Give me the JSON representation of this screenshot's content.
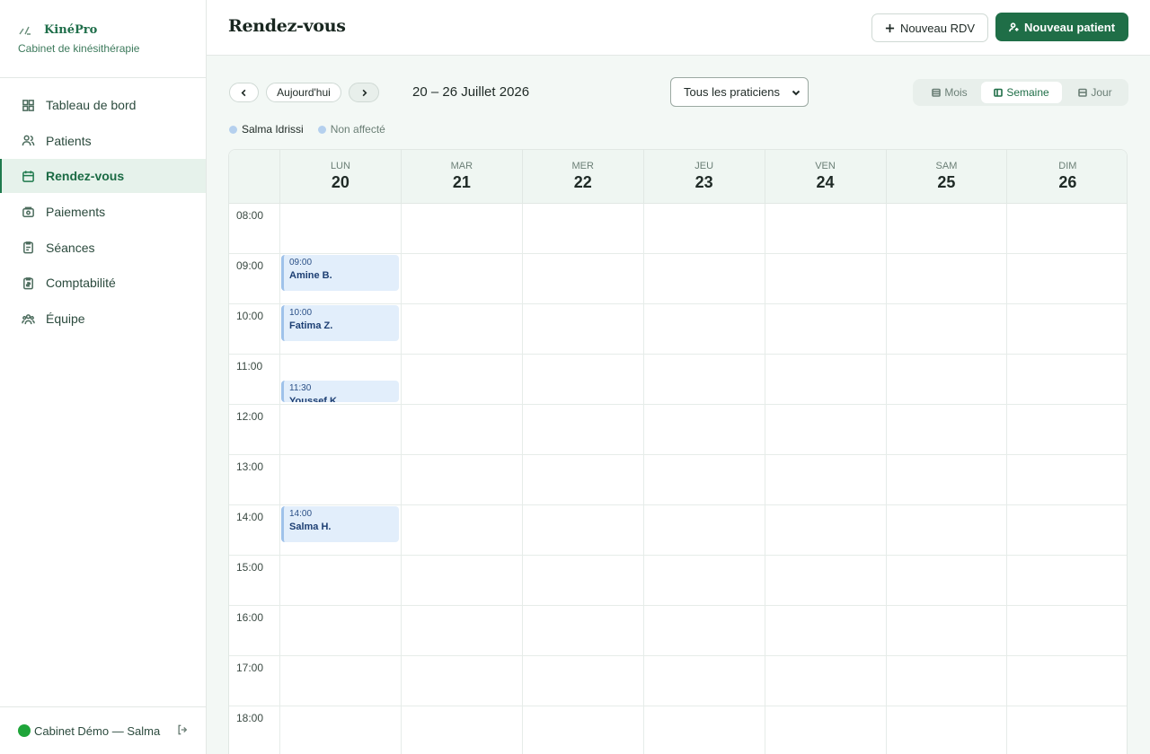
{
  "brand": {
    "name": "KinéPro",
    "subtitle": "Cabinet de kinésithérapie"
  },
  "sidebar": {
    "items": [
      {
        "label": "Tableau de bord",
        "icon": "dashboard-icon"
      },
      {
        "label": "Patients",
        "icon": "users-icon"
      },
      {
        "label": "Rendez-vous",
        "icon": "calendar-icon",
        "active": true
      },
      {
        "label": "Paiements",
        "icon": "wallet-icon"
      },
      {
        "label": "Séances",
        "icon": "clipboard-icon"
      },
      {
        "label": "Comptabilité",
        "icon": "ledger-icon"
      },
      {
        "label": "Équipe",
        "icon": "team-icon"
      }
    ],
    "footer": {
      "label": "Cabinet Démo — Salma",
      "status_color": "#1fa53a"
    }
  },
  "header": {
    "title": "Rendez-vous",
    "new_appointment": "Nouveau RDV",
    "new_patient": "Nouveau patient"
  },
  "toolbar": {
    "today": "Aujourd'hui",
    "date_range": "20 – 26 Juillet 2026",
    "practitioner_select": "Tous les praticiens",
    "views": [
      {
        "label": "Mois",
        "icon": "month-icon"
      },
      {
        "label": "Semaine",
        "icon": "week-icon",
        "active": true
      },
      {
        "label": "Jour",
        "icon": "day-icon"
      }
    ]
  },
  "legend": [
    {
      "label": "Salma Idrissi",
      "color": "#b5d0ee"
    },
    {
      "label": "Non affecté",
      "color": "#b5d0ee"
    }
  ],
  "calendar": {
    "days": [
      {
        "name": "LUN",
        "num": "20"
      },
      {
        "name": "MAR",
        "num": "21"
      },
      {
        "name": "MER",
        "num": "22"
      },
      {
        "name": "JEU",
        "num": "23"
      },
      {
        "name": "VEN",
        "num": "24"
      },
      {
        "name": "SAM",
        "num": "25"
      },
      {
        "name": "DIM",
        "num": "26"
      }
    ],
    "hours": [
      "08:00",
      "09:00",
      "10:00",
      "11:00",
      "12:00",
      "13:00",
      "14:00",
      "15:00",
      "16:00",
      "17:00",
      "18:00"
    ],
    "events": [
      {
        "day": 0,
        "start": "09:00",
        "time": "09:00",
        "name": "Amine B."
      },
      {
        "day": 0,
        "start": "10:00",
        "time": "10:00",
        "name": "Fatima Z."
      },
      {
        "day": 0,
        "start": "11:30",
        "time": "11:30",
        "name": "Youssef K."
      },
      {
        "day": 0,
        "start": "14:00",
        "time": "14:00",
        "name": "Salma H."
      }
    ]
  },
  "colors": {
    "accent": "#1f6e47",
    "event_bg": "#e2eefb",
    "event_border": "#9fc2ea"
  }
}
